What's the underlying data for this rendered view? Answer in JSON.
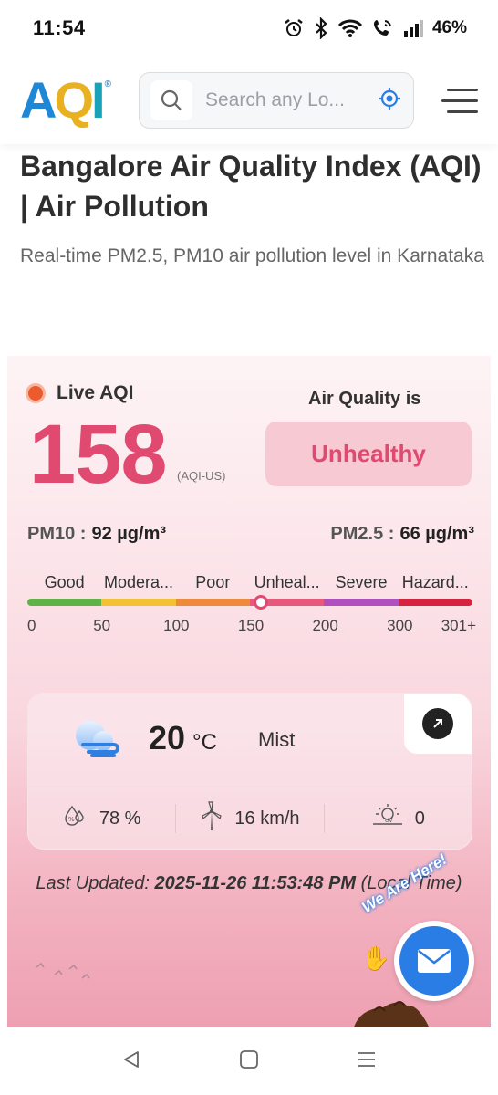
{
  "status_bar": {
    "time": "11:54",
    "battery": "46%",
    "icons": [
      "alarm-icon",
      "bluetooth-icon",
      "wifi-icon",
      "wifi-call-icon",
      "signal-icon"
    ]
  },
  "header": {
    "logo": {
      "a": "A",
      "q": "Q",
      "i": "I",
      "reg": "®"
    },
    "search_placeholder": "Search any Lo...",
    "search_icon": "search-icon",
    "locate_icon": "location-target-icon",
    "menu_icon": "hamburger-menu-icon"
  },
  "page": {
    "title": "Bangalore Air Quality Index (AQI) | Air Pollution",
    "subtitle": "Real-time PM2.5, PM10 air pollution level in Karnataka"
  },
  "aqi": {
    "live_label": "Live AQI",
    "value": "158",
    "unit": "(AQI-US)",
    "quality_label": "Air Quality is",
    "quality_status": "Unhealthy",
    "accent_color": "#e04a70",
    "pm10_label": "PM10 :",
    "pm10_value": "92 µg/m³",
    "pm25_label": "PM2.5 :",
    "pm25_value": "66 µg/m³",
    "scale_labels": [
      "Good",
      "Modera...",
      "Poor",
      "Unheal...",
      "Severe",
      "Hazard..."
    ],
    "scale_colors": [
      "#5eb246",
      "#f2c232",
      "#ee8a3a",
      "#e8587a",
      "#b04fbf",
      "#d6223f"
    ],
    "scale_ticks": [
      "0",
      "50",
      "100",
      "150",
      "200",
      "300",
      "301+"
    ],
    "marker_fraction": 0.525
  },
  "weather": {
    "temperature": "20",
    "temp_unit": "°C",
    "condition": "Mist",
    "humidity": "78 %",
    "wind": "16 km/h",
    "uv": "0",
    "weather_icon": "mist-cloud-icon",
    "humidity_icon": "humidity-icon",
    "wind_icon": "wind-turbine-icon",
    "uv_icon": "uv-sun-icon",
    "expand_icon": "arrow-up-right-icon"
  },
  "last_updated": {
    "label": "Last Updated:",
    "timestamp": "2025-11-26 11:53:48 PM",
    "suffix": "(Local Time)"
  },
  "chat": {
    "text": "We Are Here!",
    "icon": "mail-icon"
  },
  "nav_bar": {
    "icons": [
      "back-icon",
      "home-icon",
      "recents-icon"
    ]
  }
}
